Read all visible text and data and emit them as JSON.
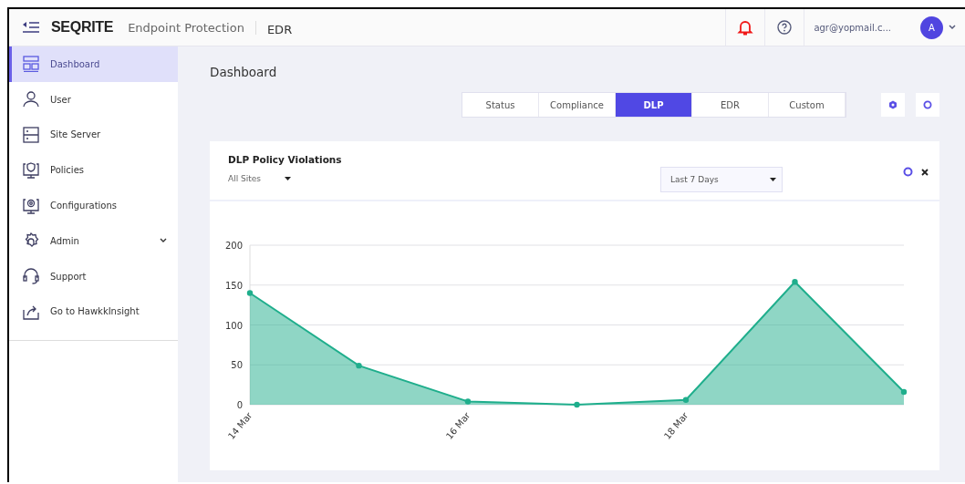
{
  "header": {
    "brand": "SEQRITE",
    "product": "Endpoint Protection",
    "module": "EDR",
    "user_email": "agr@yopmail.c...",
    "avatar_letter": "A"
  },
  "sidebar": {
    "items": [
      {
        "label": "Dashboard",
        "kind": "dashboard",
        "selected": true,
        "expandable": false
      },
      {
        "label": "User",
        "kind": "user",
        "selected": false,
        "expandable": false
      },
      {
        "label": "Site Server",
        "kind": "server",
        "selected": false,
        "expandable": false
      },
      {
        "label": "Policies",
        "kind": "policy",
        "selected": false,
        "expandable": false
      },
      {
        "label": "Configurations",
        "kind": "config",
        "selected": false,
        "expandable": false
      },
      {
        "label": "Admin",
        "kind": "admin",
        "selected": false,
        "expandable": true
      },
      {
        "label": "Support",
        "kind": "support",
        "selected": false,
        "expandable": false
      },
      {
        "label": "Go to HawkkInsight",
        "kind": "share",
        "selected": false,
        "expandable": false
      }
    ]
  },
  "page_title": "Dashboard",
  "tabs": [
    {
      "label": "Status",
      "selected": false
    },
    {
      "label": "Compliance",
      "selected": false
    },
    {
      "label": "DLP",
      "selected": true
    },
    {
      "label": "EDR",
      "selected": false
    },
    {
      "label": "Custom",
      "selected": false
    }
  ],
  "widget": {
    "title": "DLP Policy Violations",
    "site_filter": "All Sites",
    "range_filter": "Last 7 Days",
    "chart_data": {
      "type": "area",
      "categories": [
        "14 Mar",
        null,
        "16 Mar",
        null,
        "18 Mar",
        null,
        null
      ],
      "series": [
        {
          "color": "#1fae8c",
          "values": [
            140,
            49,
            4,
            0,
            6,
            154,
            16
          ]
        }
      ],
      "ylim": [
        0,
        200
      ],
      "yticks": [
        0,
        50,
        100,
        150,
        200
      ],
      "grid": true
    }
  }
}
